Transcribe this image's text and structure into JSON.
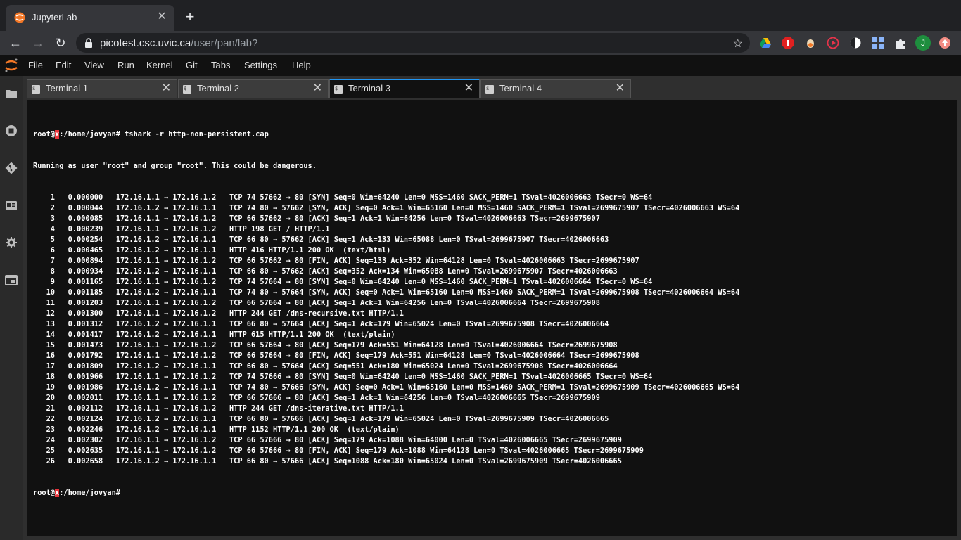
{
  "browser": {
    "tab_title": "JupyterLab",
    "url_host": "picotest.csc.uvic.ca",
    "url_path": "/user/pan/lab?",
    "profile_initial": "J",
    "colors": {
      "chrome_bg": "#202124",
      "toolbar_bg": "#35363a",
      "profile": "#1e8e3e"
    }
  },
  "menubar": {
    "items": [
      "File",
      "Edit",
      "View",
      "Run",
      "Kernel",
      "Git",
      "Tabs",
      "Settings",
      "Help"
    ]
  },
  "sidebar": {
    "icons": [
      "folder-icon",
      "running-icon",
      "git-icon",
      "commands-icon",
      "property-inspector-icon",
      "tabs-icon"
    ]
  },
  "tabs": [
    {
      "label": "Terminal 1",
      "active": false
    },
    {
      "label": "Terminal 2",
      "active": false
    },
    {
      "label": "Terminal 3",
      "active": true
    },
    {
      "label": "Terminal 4",
      "active": false
    }
  ],
  "terminal": {
    "prompt_user": "root@",
    "prompt_host_cursor": "x",
    "prompt_path": ":/home/jovyan#",
    "command": " tshark -r http-non-persistent.cap",
    "warning": "Running as user \"root\" and group \"root\". This could be dangerous.",
    "lines": [
      "    1   0.000000   172.16.1.1 → 172.16.1.2   TCP 74 57662 → 80 [SYN] Seq=0 Win=64240 Len=0 MSS=1460 SACK_PERM=1 TSval=4026006663 TSecr=0 WS=64",
      "    2   0.000044   172.16.1.2 → 172.16.1.1   TCP 74 80 → 57662 [SYN, ACK] Seq=0 Ack=1 Win=65160 Len=0 MSS=1460 SACK_PERM=1 TSval=2699675907 TSecr=4026006663 WS=64",
      "    3   0.000085   172.16.1.1 → 172.16.1.2   TCP 66 57662 → 80 [ACK] Seq=1 Ack=1 Win=64256 Len=0 TSval=4026006663 TSecr=2699675907",
      "    4   0.000239   172.16.1.1 → 172.16.1.2   HTTP 198 GET / HTTP/1.1",
      "    5   0.000254   172.16.1.2 → 172.16.1.1   TCP 66 80 → 57662 [ACK] Seq=1 Ack=133 Win=65088 Len=0 TSval=2699675907 TSecr=4026006663",
      "    6   0.000465   172.16.1.2 → 172.16.1.1   HTTP 416 HTTP/1.1 200 OK  (text/html)",
      "    7   0.000894   172.16.1.1 → 172.16.1.2   TCP 66 57662 → 80 [FIN, ACK] Seq=133 Ack=352 Win=64128 Len=0 TSval=4026006663 TSecr=2699675907",
      "    8   0.000934   172.16.1.2 → 172.16.1.1   TCP 66 80 → 57662 [ACK] Seq=352 Ack=134 Win=65088 Len=0 TSval=2699675907 TSecr=4026006663",
      "    9   0.001165   172.16.1.1 → 172.16.1.2   TCP 74 57664 → 80 [SYN] Seq=0 Win=64240 Len=0 MSS=1460 SACK_PERM=1 TSval=4026006664 TSecr=0 WS=64",
      "   10   0.001185   172.16.1.2 → 172.16.1.1   TCP 74 80 → 57664 [SYN, ACK] Seq=0 Ack=1 Win=65160 Len=0 MSS=1460 SACK_PERM=1 TSval=2699675908 TSecr=4026006664 WS=64",
      "   11   0.001203   172.16.1.1 → 172.16.1.2   TCP 66 57664 → 80 [ACK] Seq=1 Ack=1 Win=64256 Len=0 TSval=4026006664 TSecr=2699675908",
      "   12   0.001300   172.16.1.1 → 172.16.1.2   HTTP 244 GET /dns-recursive.txt HTTP/1.1",
      "   13   0.001312   172.16.1.2 → 172.16.1.1   TCP 66 80 → 57664 [ACK] Seq=1 Ack=179 Win=65024 Len=0 TSval=2699675908 TSecr=4026006664",
      "   14   0.001417   172.16.1.2 → 172.16.1.1   HTTP 615 HTTP/1.1 200 OK  (text/plain)",
      "   15   0.001473   172.16.1.1 → 172.16.1.2   TCP 66 57664 → 80 [ACK] Seq=179 Ack=551 Win=64128 Len=0 TSval=4026006664 TSecr=2699675908",
      "   16   0.001792   172.16.1.1 → 172.16.1.2   TCP 66 57664 → 80 [FIN, ACK] Seq=179 Ack=551 Win=64128 Len=0 TSval=4026006664 TSecr=2699675908",
      "   17   0.001809   172.16.1.2 → 172.16.1.1   TCP 66 80 → 57664 [ACK] Seq=551 Ack=180 Win=65024 Len=0 TSval=2699675908 TSecr=4026006664",
      "   18   0.001966   172.16.1.1 → 172.16.1.2   TCP 74 57666 → 80 [SYN] Seq=0 Win=64240 Len=0 MSS=1460 SACK_PERM=1 TSval=4026006665 TSecr=0 WS=64",
      "   19   0.001986   172.16.1.2 → 172.16.1.1   TCP 74 80 → 57666 [SYN, ACK] Seq=0 Ack=1 Win=65160 Len=0 MSS=1460 SACK_PERM=1 TSval=2699675909 TSecr=4026006665 WS=64",
      "   20   0.002011   172.16.1.1 → 172.16.1.2   TCP 66 57666 → 80 [ACK] Seq=1 Ack=1 Win=64256 Len=0 TSval=4026006665 TSecr=2699675909",
      "   21   0.002112   172.16.1.1 → 172.16.1.2   HTTP 244 GET /dns-iterative.txt HTTP/1.1",
      "   22   0.002124   172.16.1.2 → 172.16.1.1   TCP 66 80 → 57666 [ACK] Seq=1 Ack=179 Win=65024 Len=0 TSval=2699675909 TSecr=4026006665",
      "   23   0.002246   172.16.1.2 → 172.16.1.1   HTTP 1152 HTTP/1.1 200 OK  (text/plain)",
      "   24   0.002302   172.16.1.1 → 172.16.1.2   TCP 66 57666 → 80 [ACK] Seq=179 Ack=1088 Win=64000 Len=0 TSval=4026006665 TSecr=2699675909",
      "   25   0.002635   172.16.1.1 → 172.16.1.2   TCP 66 57666 → 80 [FIN, ACK] Seq=179 Ack=1088 Win=64128 Len=0 TSval=4026006665 TSecr=2699675909",
      "   26   0.002658   172.16.1.2 → 172.16.1.1   TCP 66 80 → 57666 [ACK] Seq=1088 Ack=180 Win=65024 Len=0 TSval=2699675909 TSecr=4026006665"
    ]
  }
}
